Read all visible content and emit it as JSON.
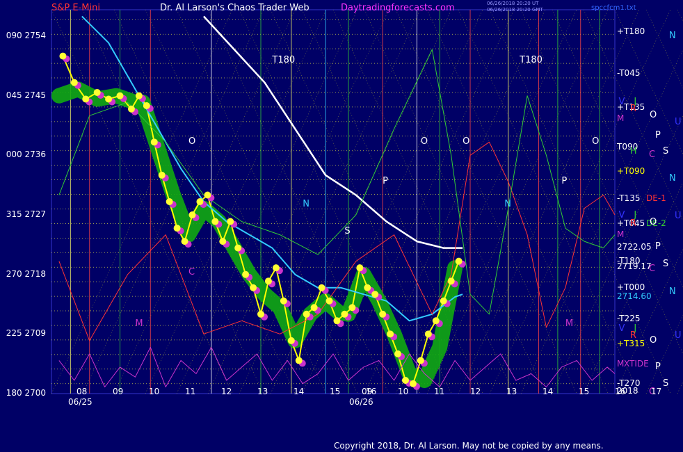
{
  "header": {
    "left_title": "S&P E-Mini",
    "center_title": "Dr. Al Larson's Chaos Trader Web",
    "site": "Daytradingforecasts.com",
    "date_line_1": "06/26/2018 20:20 UT",
    "date_line_2": "06/26/2018 20:20 GMT",
    "file_name": "spccfcm1.txt"
  },
  "footer": "Copyright 2018, Dr. Al Larson. May not be copied by any means.",
  "colors": {
    "background": "#000066",
    "price_bar": "#ffff00",
    "price_dot": "#ffff33",
    "ma_white": "#ffffff",
    "ma_cyan": "#33ccff",
    "cycle_red": "#ff3333",
    "cycle_green": "#33cc33",
    "xtide": "#cc33cc",
    "glow_green": "#11aa11",
    "glow_magenta": "#cc33cc"
  },
  "chart_data": {
    "type": "line",
    "title": "S&P E-Mini",
    "ylim": [
      2700,
      2758
    ],
    "y_ticks": [
      {
        "angle": "090",
        "price": 2754
      },
      {
        "angle": "045",
        "price": 2745
      },
      {
        "angle": "000",
        "price": 2736
      },
      {
        "angle": "315",
        "price": 2727
      },
      {
        "angle": "270",
        "price": 2718
      },
      {
        "angle": "225",
        "price": 2709
      },
      {
        "angle": "180",
        "price": 2700
      }
    ],
    "xlim": [
      5,
      19.8
    ],
    "x_hour_labels": [
      {
        "x": 8,
        "text": "08"
      },
      {
        "x": 9,
        "text": "09"
      },
      {
        "x": 10,
        "text": "10"
      },
      {
        "x": 11,
        "text": "11"
      },
      {
        "x": 12,
        "text": "12"
      },
      {
        "x": 13,
        "text": "13"
      },
      {
        "x": 14,
        "text": "14"
      },
      {
        "x": 15,
        "text": "15"
      },
      {
        "x": 16,
        "text": "16"
      },
      {
        "x": 9.2,
        "text": "09"
      },
      {
        "x": 10.2,
        "text": "10"
      },
      {
        "x": 11.2,
        "text": "11"
      },
      {
        "x": 12.2,
        "text": "12"
      },
      {
        "x": 13.2,
        "text": "13"
      },
      {
        "x": 14.2,
        "text": "14"
      },
      {
        "x": 15.2,
        "text": "15"
      },
      {
        "x": 16.2,
        "text": "16"
      },
      {
        "x": 17.2,
        "text": "17"
      }
    ],
    "dates": [
      "06/25",
      "06/26"
    ],
    "right_labels": [
      {
        "text": "+T180",
        "price": 2754.6,
        "color": "#ffffff"
      },
      {
        "text": "-T045",
        "price": 2748.3,
        "color": "#ffffff"
      },
      {
        "text": "+T135",
        "price": 2743.2,
        "color": "#ffffff"
      },
      {
        "text": "M",
        "price": 2741.5,
        "color": "#cc33cc"
      },
      {
        "text": "T090",
        "price": 2737.2,
        "color": "#ffffff"
      },
      {
        "text": "+T090",
        "price": 2733.5,
        "color": "#ffff00"
      },
      {
        "text": "-T135",
        "price": 2729.4,
        "color": "#ffffff"
      },
      {
        "text": "DE-1",
        "price": 2729.4,
        "color": "#ff3333"
      },
      {
        "text": "+T045",
        "price": 2725.6,
        "color": "#ffffff"
      },
      {
        "text": "DE-2",
        "price": 2725.6,
        "color": "#33cc33"
      },
      {
        "text": "M",
        "price": 2724.0,
        "color": "#cc33cc"
      },
      {
        "text": "2722.05",
        "price": 2722.05,
        "color": "#ffffff"
      },
      {
        "text": "-T180",
        "price": 2720.0,
        "color": "#ffffff"
      },
      {
        "text": "2719.17",
        "price": 2719.17,
        "color": "#ffffff"
      },
      {
        "text": "+T000",
        "price": 2716.0,
        "color": "#ffffff"
      },
      {
        "text": "2714.60",
        "price": 2714.6,
        "color": "#33ccff"
      },
      {
        "text": "-T225",
        "price": 2711.2,
        "color": "#ffffff"
      },
      {
        "text": "+T315",
        "price": 2707.5,
        "color": "#ffff00"
      },
      {
        "text": "M",
        "price": 2704.4,
        "color": "#cc33cc"
      },
      {
        "text": "XTIDE",
        "price": 2704.4,
        "color": "#cc33cc"
      },
      {
        "text": "-T270",
        "price": 2701.5,
        "color": "#ffffff"
      },
      {
        "text": "2018",
        "price": 2700.3,
        "color": "#ffffff"
      }
    ],
    "far_right_letters": [
      {
        "text": "N",
        "price": 2754.0,
        "color": "#33ccff"
      },
      {
        "text": "O",
        "price": 2742.0,
        "color": "#ffffff"
      },
      {
        "text": "U",
        "price": 2741.0,
        "color": "#3333ff"
      },
      {
        "text": "P",
        "price": 2739.0,
        "color": "#ffffff"
      },
      {
        "text": "S",
        "price": 2736.6,
        "color": "#ffffff"
      },
      {
        "text": "C",
        "price": 2736.0,
        "color": "#cc33cc"
      },
      {
        "text": "N",
        "price": 2732.5,
        "color": "#33ccff"
      },
      {
        "text": "U",
        "price": 2726.8,
        "color": "#3333ff"
      },
      {
        "text": "O",
        "price": 2725.9,
        "color": "#ffffff"
      },
      {
        "text": "P",
        "price": 2722.2,
        "color": "#ffffff"
      },
      {
        "text": "S",
        "price": 2719.5,
        "color": "#ffffff"
      },
      {
        "text": "C",
        "price": 2718.8,
        "color": "#cc33cc"
      },
      {
        "text": "N",
        "price": 2715.3,
        "color": "#33ccff"
      },
      {
        "text": "U",
        "price": 2708.7,
        "color": "#3333ff"
      },
      {
        "text": "O",
        "price": 2708.0,
        "color": "#ffffff"
      },
      {
        "text": "P",
        "price": 2704.0,
        "color": "#ffffff"
      },
      {
        "text": "S",
        "price": 2701.5,
        "color": "#ffffff"
      },
      {
        "text": "C",
        "price": 2700.2,
        "color": "#cc33cc"
      }
    ],
    "chart_letters": [
      {
        "text": "T180",
        "x": 10.8,
        "price": 2750.3,
        "color": "#ffffff"
      },
      {
        "text": "T180",
        "x": 17.3,
        "price": 2750.3,
        "color": "#ffffff"
      },
      {
        "text": "O",
        "x": 8.6,
        "price": 2738.0,
        "color": "#ffffff"
      },
      {
        "text": "O",
        "x": 14.7,
        "price": 2738.0,
        "color": "#ffffff"
      },
      {
        "text": "O",
        "x": 15.8,
        "price": 2738.0,
        "color": "#ffffff"
      },
      {
        "text": "O",
        "x": 19.2,
        "price": 2738.0,
        "color": "#ffffff"
      },
      {
        "text": "N",
        "x": 11.6,
        "price": 2728.6,
        "color": "#33ccff"
      },
      {
        "text": "N",
        "x": 16.9,
        "price": 2728.6,
        "color": "#33ccff"
      },
      {
        "text": "P",
        "x": 13.7,
        "price": 2732.0,
        "color": "#ffffff"
      },
      {
        "text": "P",
        "x": 18.4,
        "price": 2732.0,
        "color": "#ffffff"
      },
      {
        "text": "S",
        "x": 12.7,
        "price": 2724.5,
        "color": "#ffffff"
      },
      {
        "text": "C",
        "x": 8.6,
        "price": 2718.3,
        "color": "#cc33cc"
      },
      {
        "text": "M",
        "x": 7.2,
        "price": 2710.5,
        "color": "#cc33cc"
      },
      {
        "text": "M",
        "x": 18.5,
        "price": 2710.5,
        "color": "#cc33cc"
      },
      {
        "text": "V",
        "x": 19.9,
        "price": 2744.0,
        "color": "#3333ff"
      },
      {
        "text": "J",
        "x": 20.3,
        "price": 2744.0,
        "color": "#33cc33"
      },
      {
        "text": "R",
        "x": 20.2,
        "price": 2743.0,
        "color": "#ff3333"
      },
      {
        "text": "H",
        "x": 20.2,
        "price": 2736.6,
        "color": "#33cc33"
      },
      {
        "text": "V",
        "x": 19.9,
        "price": 2726.9,
        "color": "#3333ff"
      },
      {
        "text": "J",
        "x": 20.3,
        "price": 2726.9,
        "color": "#33cc33"
      },
      {
        "text": "R",
        "x": 20.2,
        "price": 2725.6,
        "color": "#ff3333"
      },
      {
        "text": "V",
        "x": 19.9,
        "price": 2709.8,
        "color": "#3333ff"
      },
      {
        "text": "J",
        "x": 20.3,
        "price": 2709.8,
        "color": "#33cc33"
      },
      {
        "text": "R",
        "x": 20.2,
        "price": 2708.7,
        "color": "#ff3333"
      }
    ],
    "series": [
      {
        "name": "price",
        "color": "#ffff00",
        "x": [
          5.3,
          5.6,
          5.9,
          6.2,
          6.5,
          6.8,
          7.1,
          7.3,
          7.5,
          7.7,
          7.9,
          8.1,
          8.3,
          8.5,
          8.7,
          8.9,
          9.1,
          9.3,
          9.5,
          9.7,
          9.9,
          10.1,
          10.3,
          10.5,
          10.7,
          10.9,
          11.1,
          11.3,
          11.5,
          11.7,
          11.9,
          12.1,
          12.3,
          12.5,
          12.7,
          12.9,
          13.1,
          13.3,
          13.5,
          13.7,
          13.9,
          14.1,
          14.3,
          14.5,
          14.7,
          14.9,
          15.1,
          15.3,
          15.5,
          15.7
        ],
        "values": [
          2751,
          2747,
          2744.5,
          2745.5,
          2744.5,
          2745,
          2743,
          2745,
          2743.5,
          2738,
          2733,
          2729,
          2725,
          2723,
          2727,
          2729,
          2730,
          2726,
          2723,
          2726,
          2722,
          2718,
          2716,
          2712,
          2717,
          2719,
          2714,
          2708,
          2705,
          2712,
          2713,
          2716,
          2714,
          2711,
          2712,
          2713,
          2719,
          2716,
          2715,
          2712,
          2709,
          2706,
          2702,
          2701.5,
          2705,
          2709,
          2711,
          2714,
          2717,
          2720
        ]
      },
      {
        "name": "ma-white",
        "color": "#ffffff",
        "x": [
          9.0,
          9.8,
          10.6,
          11.4,
          12.2,
          13.0,
          13.8,
          14.6,
          15.3,
          15.8
        ],
        "values": [
          2757,
          2752,
          2747,
          2740,
          2733,
          2730,
          2726,
          2723,
          2722,
          2722
        ]
      },
      {
        "name": "ma-cyan",
        "color": "#33ccff",
        "x": [
          5.8,
          6.5,
          7.2,
          7.8,
          8.4,
          9.0,
          9.6,
          10.2,
          10.8,
          11.4,
          12.0,
          12.6,
          13.2,
          13.8,
          14.4,
          15.0,
          15.6,
          15.8
        ],
        "values": [
          2757,
          2753,
          2746,
          2740,
          2734,
          2729,
          2726,
          2724,
          2722,
          2718,
          2716,
          2716,
          2715,
          2714,
          2711,
          2712,
          2714.6,
          2715
        ]
      },
      {
        "name": "cycle-red",
        "color": "#ff3333",
        "x": [
          5.2,
          6.0,
          7.0,
          8.0,
          9.0,
          10.0,
          11.0,
          12.0,
          13.0,
          14.0,
          15.0,
          15.5,
          16.0,
          16.5,
          17.0,
          17.5,
          18.0,
          18.5,
          19.0,
          19.5,
          19.8
        ],
        "values": [
          2720,
          2708,
          2718,
          2724,
          2709,
          2711,
          2709,
          2712,
          2720,
          2724,
          2712,
          2718,
          2736,
          2738,
          2732,
          2724,
          2710,
          2716,
          2728,
          2730,
          2727
        ]
      },
      {
        "name": "cycle-green",
        "color": "#33cc33",
        "x": [
          5.2,
          6.0,
          7.0,
          8.0,
          9.0,
          10.0,
          11.0,
          12.0,
          13.0,
          14.0,
          15.0,
          15.5,
          16.0,
          16.5,
          17.0,
          17.5,
          18.0,
          18.5,
          19.0,
          19.5,
          19.8
        ],
        "values": [
          2730,
          2742,
          2744,
          2738,
          2730,
          2726,
          2724,
          2721,
          2727,
          2740,
          2752,
          2736,
          2715,
          2712,
          2728,
          2745,
          2736,
          2725,
          2723,
          2722,
          2724
        ]
      },
      {
        "name": "xtide",
        "color": "#cc33cc",
        "x": [
          5.2,
          5.6,
          6.0,
          6.4,
          6.8,
          7.2,
          7.6,
          8.0,
          8.4,
          8.8,
          9.2,
          9.6,
          10.0,
          10.4,
          10.8,
          11.2,
          11.6,
          12.0,
          12.4,
          12.8,
          13.2,
          13.6,
          14.0,
          14.4,
          14.8,
          15.2,
          15.6,
          16.0,
          16.4,
          16.8,
          17.2,
          17.6,
          18.0,
          18.4,
          18.8,
          19.2,
          19.6,
          19.8
        ],
        "values": [
          2705,
          2702,
          2706,
          2701,
          2704,
          2702.5,
          2707,
          2701,
          2705,
          2703,
          2707,
          2702,
          2704,
          2706,
          2702,
          2705,
          2701.5,
          2703,
          2706,
          2702,
          2704,
          2705,
          2702,
          2706,
          2703,
          2701,
          2705,
          2702,
          2704,
          2706,
          2702,
          2703,
          2701,
          2704,
          2705,
          2702,
          2704,
          2703
        ]
      }
    ],
    "glow_segments": [
      {
        "x": [
          5.2,
          5.7,
          6.2,
          6.7,
          7.2
        ],
        "values": [
          2745,
          2746,
          2744.5,
          2745,
          2744
        ],
        "color": "#11aa11"
      },
      {
        "x": [
          7.4,
          7.8,
          8.2,
          8.6,
          9.0,
          9.4,
          9.8,
          10.2,
          10.6,
          11.0,
          11.4,
          11.8,
          12.2,
          12.6
        ],
        "values": [
          2744,
          2737,
          2730,
          2724,
          2728,
          2726,
          2722,
          2718,
          2715,
          2713,
          2708,
          2712,
          2714,
          2712
        ],
        "color": "#11aa11"
      },
      {
        "x": [
          12.8,
          13.2,
          13.6,
          14.0,
          14.4,
          14.8,
          15.2,
          15.6
        ],
        "values": [
          2712,
          2718,
          2714,
          2709,
          2703,
          2702,
          2707,
          2719
        ],
        "color": "#11aa11"
      }
    ],
    "vertical_lines": [
      {
        "x": 5.5,
        "color": "#ffff66"
      },
      {
        "x": 6.0,
        "color": "#ff4444"
      },
      {
        "x": 6.8,
        "color": "#33cc33"
      },
      {
        "x": 7.6,
        "color": "#ff4444"
      },
      {
        "x": 9.2,
        "color": "#ffffff"
      },
      {
        "x": 10.5,
        "color": "#33cc33"
      },
      {
        "x": 11.3,
        "color": "#ffff66"
      },
      {
        "x": 12.2,
        "color": "#33ccff"
      },
      {
        "x": 12.8,
        "color": "#33cc33"
      },
      {
        "x": 13.7,
        "color": "#ff4444"
      },
      {
        "x": 14.6,
        "color": "#ffffff"
      },
      {
        "x": 15.2,
        "color": "#33cc33"
      },
      {
        "x": 16.0,
        "color": "#ff4444"
      },
      {
        "x": 17.0,
        "color": "#ffff66"
      },
      {
        "x": 17.8,
        "color": "#ff4444"
      },
      {
        "x": 18.3,
        "color": "#33cc33"
      },
      {
        "x": 18.9,
        "color": "#ff4444"
      },
      {
        "x": 19.4,
        "color": "#33cc33"
      }
    ]
  }
}
